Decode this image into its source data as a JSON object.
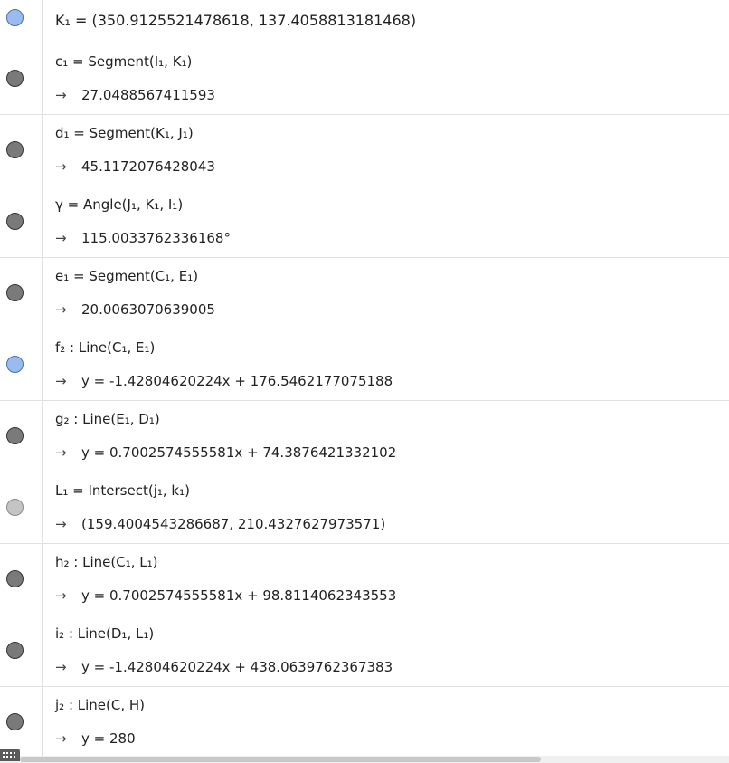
{
  "rows": [
    {
      "marble": "blue",
      "definition": "K₁ = (350.9125521478618, 137.4058813181468)",
      "output": null
    },
    {
      "marble": "dark",
      "definition": "c₁ = Segment(I₁, K₁)",
      "output": "27.0488567411593"
    },
    {
      "marble": "dark",
      "definition": "d₁ = Segment(K₁, J₁)",
      "output": "45.1172076428043"
    },
    {
      "marble": "dark",
      "definition": "γ = Angle(J₁, K₁, I₁)",
      "output": "115.0033762336168°"
    },
    {
      "marble": "dark",
      "definition": "e₁ = Segment(C₁, E₁)",
      "output": "20.0063070639005"
    },
    {
      "marble": "blue",
      "definition": "f₂ : Line(C₁, E₁)",
      "output": "y = -1.42804620224x + 176.5462177075188"
    },
    {
      "marble": "dark",
      "definition": "g₂ : Line(E₁, D₁)",
      "output": "y = 0.7002574555581x + 74.3876421332102"
    },
    {
      "marble": "gray",
      "definition": "L₁ = Intersect(j₁, k₁)",
      "output": "(159.4004543286687, 210.4327627973571)"
    },
    {
      "marble": "dark",
      "definition": "h₂ : Line(C₁, L₁)",
      "output": "y = 0.7002574555581x + 98.8114062343553"
    },
    {
      "marble": "dark",
      "definition": "i₂ : Line(D₁, L₁)",
      "output": "y = -1.42804620224x + 438.0639762367383"
    },
    {
      "marble": "dark",
      "definition": "j₂ : Line(C, H)",
      "output": "y = 280"
    }
  ],
  "arrow_glyph": "→",
  "icons": {
    "marble": "visibility-marble-icon",
    "keyboard": "keyboard-icon"
  }
}
